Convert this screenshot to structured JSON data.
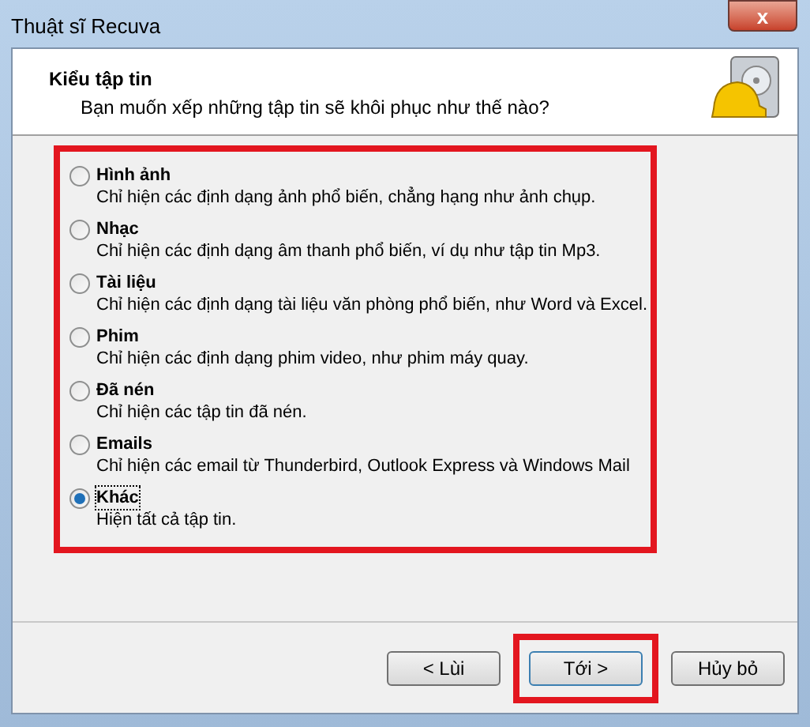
{
  "window": {
    "title": "Thuật sĩ Recuva",
    "close": "x"
  },
  "header": {
    "title": "Kiểu tập tin",
    "subtitle": "Bạn muốn xếp những tập tin sẽ khôi phục như thế nào?"
  },
  "options": [
    {
      "label": "Hình ảnh",
      "description": "Chỉ hiện các định dạng ảnh phổ biến, chẳng hạng như ảnh chụp.",
      "selected": false
    },
    {
      "label": "Nhạc",
      "description": "Chỉ hiện các định dạng âm thanh phổ biến, ví dụ như tập tin Mp3.",
      "selected": false
    },
    {
      "label": "Tài liệu",
      "description": "Chỉ hiện các định dạng tài liệu văn phòng phổ biến, như Word và Excel.",
      "selected": false
    },
    {
      "label": "Phim",
      "description": "Chỉ hiện các định dạng phim video, như phim máy quay.",
      "selected": false
    },
    {
      "label": "Đã nén",
      "description": "Chỉ hiện các tập tin đã nén.",
      "selected": false
    },
    {
      "label": "Emails",
      "description": "Chỉ hiện các email từ Thunderbird, Outlook Express và Windows Mail",
      "selected": false
    },
    {
      "label": "Khác",
      "description": "Hiện tất cả tập tin.",
      "selected": true
    }
  ],
  "buttons": [
    {
      "label": "< Lùi",
      "highlighted": false
    },
    {
      "label": "Tới >",
      "highlighted": true
    },
    {
      "label": "Hủy bỏ",
      "highlighted": false
    }
  ]
}
